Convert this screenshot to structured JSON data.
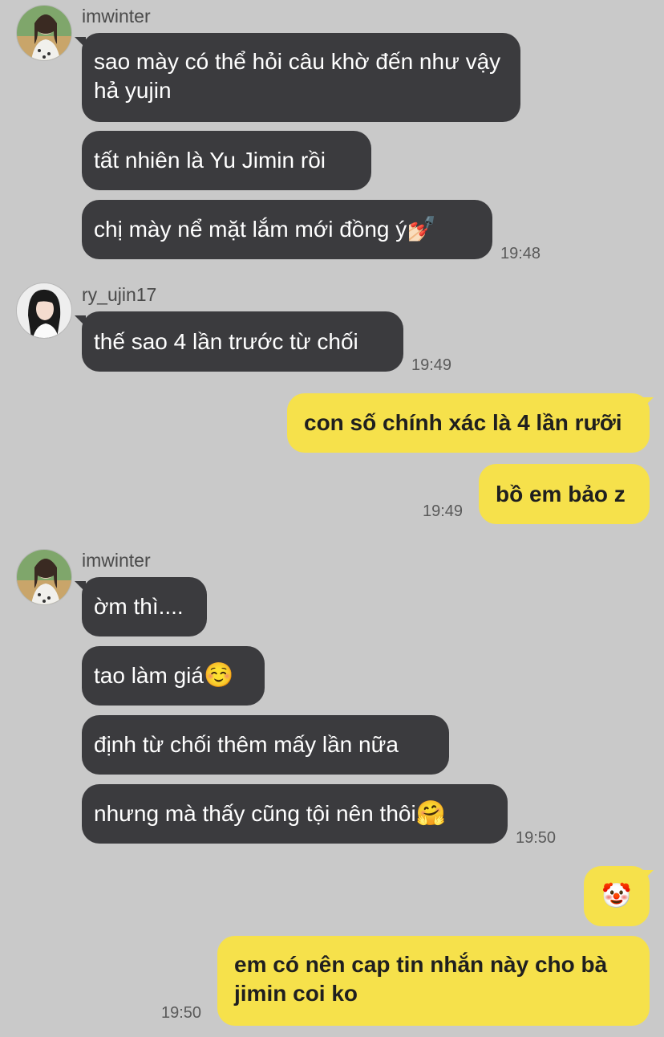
{
  "messages": {
    "g1": {
      "sender": "imwinter",
      "m1": "sao mày có thể hỏi câu khờ đến như vậy hả yujin",
      "m2": "tất nhiên là Yu Jimin rồi",
      "m3": "chị mày nể mặt lắm mới đồng ý",
      "m3_emoji": "💅🏻",
      "time": "19:48"
    },
    "g2": {
      "sender": "ry_ujin17",
      "m1": "thế sao 4 lần trước từ chối",
      "time": "19:49"
    },
    "g3": {
      "m1": "con số chính xác là 4 lần rưỡi",
      "m2": "bồ em bảo z",
      "time": "19:49"
    },
    "g4": {
      "sender": "imwinter",
      "m1": "ờm thì....",
      "m2": "tao làm giá",
      "m2_emoji": "☺️",
      "m3": "định từ chối thêm mấy lần nữa",
      "m4": "nhưng mà thấy cũng tội nên thôi",
      "m4_emoji": "🤗",
      "time": "19:50"
    },
    "g5": {
      "m1_emoji": "🤡",
      "m2": "em có nên cap tin nhắn này cho bà jimin coi ko",
      "time": "19:50"
    }
  }
}
